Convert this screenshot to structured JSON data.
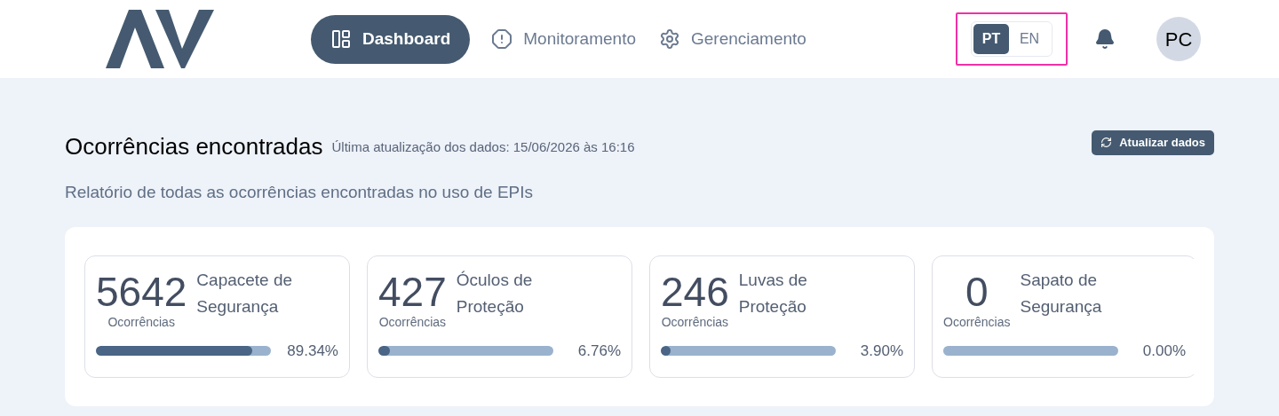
{
  "nav": [
    {
      "label": "Dashboard",
      "kind": "layout",
      "selected": true
    },
    {
      "label": "Monitoramento",
      "kind": "alert",
      "selected": false
    },
    {
      "label": "Gerenciamento",
      "kind": "gear",
      "selected": false
    }
  ],
  "languages": [
    {
      "label": "PT",
      "selected": true
    },
    {
      "label": "EN",
      "selected": false
    }
  ],
  "avatar": "PC",
  "header": {
    "title": "Ocorrências encontradas",
    "updated": "Última atualização dos dados: 15/06/2026 às 16:16",
    "subtitle": "Relatório de todas as ocorrências encontradas no uso de EPIs",
    "refresh_button": "Atualizar dados"
  },
  "cards": [
    {
      "count": "5642",
      "count_label": "Ocorrências",
      "name": "Capacete de Segurança",
      "level": 0.8934,
      "percent": "89.34%"
    },
    {
      "count": "427",
      "count_label": "Ocorrências",
      "name": "Óculos de Proteção",
      "level": 0.0676,
      "percent": "6.76%"
    },
    {
      "count": "246",
      "count_label": "Ocorrências",
      "name": "Luvas de Proteção",
      "level": 0.039,
      "percent": "3.90%"
    },
    {
      "count": "0",
      "count_label": "Ocorrências",
      "name": "Sapato de Segurança",
      "level": 0,
      "percent": "0.00%"
    }
  ]
}
